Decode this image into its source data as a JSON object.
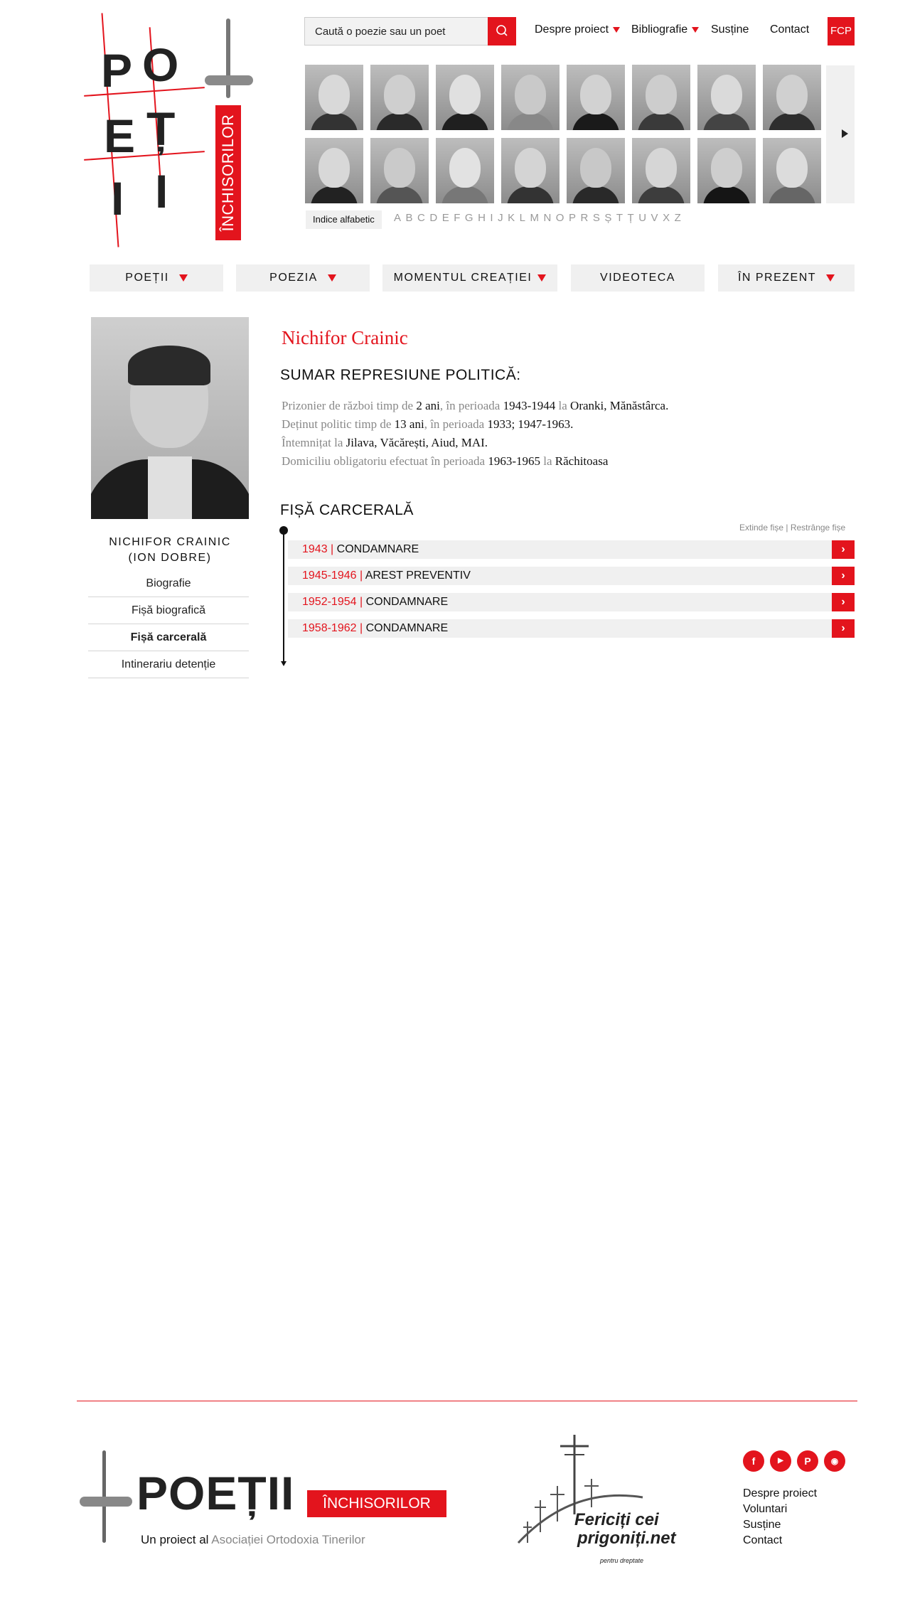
{
  "logo": {
    "letters": [
      "P",
      "O",
      "E",
      "Ț",
      "I",
      "I"
    ],
    "banner": "ÎNCHISORILOR"
  },
  "search": {
    "placeholder": "Caută o poezie sau un poet"
  },
  "topnav": {
    "despre": "Despre proiect",
    "bibliografie": "Bibliografie",
    "sustine": "Susține",
    "contact": "Contact",
    "fcp": "FCP"
  },
  "portraits": [
    {
      "face": "#d9d9d9",
      "body": "#333"
    },
    {
      "face": "#cfcfcf",
      "body": "#2a2a2a"
    },
    {
      "face": "#e0e0e0",
      "body": "#1f1f1f"
    },
    {
      "face": "#c9c9c9",
      "body": "#888"
    },
    {
      "face": "#d2d2d2",
      "body": "#1a1a1a"
    },
    {
      "face": "#cdcdcd",
      "body": "#3a3a3a"
    },
    {
      "face": "#dadada",
      "body": "#444"
    },
    {
      "face": "#d0d0d0",
      "body": "#2e2e2e"
    },
    {
      "face": "#d8d8d8",
      "body": "#222"
    },
    {
      "face": "#cacaca",
      "body": "#555"
    },
    {
      "face": "#e2e2e2",
      "body": "#777"
    },
    {
      "face": "#d4d4d4",
      "body": "#333"
    },
    {
      "face": "#c8c8c8",
      "body": "#292929"
    },
    {
      "face": "#d6d6d6",
      "body": "#3d3d3d"
    },
    {
      "face": "#cecece",
      "body": "#151515"
    },
    {
      "face": "#dcdcdc",
      "body": "#666"
    }
  ],
  "index_label": "Indice alfabetic",
  "alphabet": [
    "A",
    "B",
    "C",
    "D",
    "E",
    "F",
    "G",
    "H",
    "I",
    "J",
    "K",
    "L",
    "M",
    "N",
    "O",
    "P",
    "R",
    "S",
    "Ș",
    "T",
    "Ț",
    "U",
    "V",
    "X",
    "Z"
  ],
  "mainnav": {
    "poetii": "POEȚII",
    "poezia": "POEZIA",
    "momentul": "MOMENTUL CREAȚIEI",
    "videoteca": "VIDEOTECA",
    "prezent": "ÎN PREZENT"
  },
  "poet": {
    "name_upper": "NICHIFOR CRAINIC",
    "alias": "(ION DOBRE)",
    "title": "Nichifor Crainic"
  },
  "sidebar": {
    "items": [
      "Biografie",
      "Fișă biografică",
      "Fișă carcerală",
      "Intinerariu detenție"
    ]
  },
  "summary": {
    "heading": "SUMAR REPRESIUNE POLITICĂ:",
    "l1": {
      "a": "Prizonier de război timp de ",
      "b": "2 ani",
      "c": ", în perioada ",
      "d": "1943-1944",
      "e": " la ",
      "f": "Oranki, Mănăstârca."
    },
    "l2": {
      "a": "Deținut politic timp de ",
      "b": "13 ani",
      "c": ", în perioada ",
      "d": "1933; 1947-1963."
    },
    "l3": {
      "a": "Întemnițat la ",
      "b": "Jilava, Văcărești, Aiud, MAI."
    },
    "l4": {
      "a": "Domiciliu obligatoriu efectuat în perioada ",
      "b": "1963-1965",
      "c": " la ",
      "d": "Răchitoasa"
    }
  },
  "fisa": {
    "heading": "FIȘĂ CARCERALĂ",
    "extinde": "Extinde fișe",
    "restrange": "Restrânge fișe",
    "rows": [
      {
        "years": "1943",
        "label": "CONDAMNARE"
      },
      {
        "years": "1945-1946",
        "label": "AREST PREVENTIV"
      },
      {
        "years": "1952-1954",
        "label": "CONDAMNARE"
      },
      {
        "years": "1958-1962",
        "label": "CONDAMNARE"
      }
    ]
  },
  "footer": {
    "logo_text": "POEȚII",
    "logo_banner": "ÎNCHISORILOR",
    "sub_prefix": "Un proiect al ",
    "sub_org": "Asociației Ortodoxia Tinerilor",
    "fcp_t1": "Fericiți cei",
    "fcp_t2": "prigoniți.net",
    "fcp_t3": "pentru dreptate",
    "social": [
      "facebook-icon",
      "youtube-icon",
      "paypal-icon",
      "rss-icon"
    ],
    "links": [
      "Despre proiect",
      "Voluntari",
      "Susține",
      "Contact"
    ]
  },
  "colors": {
    "accent": "#e3141d",
    "panel": "#f0f0f0"
  }
}
